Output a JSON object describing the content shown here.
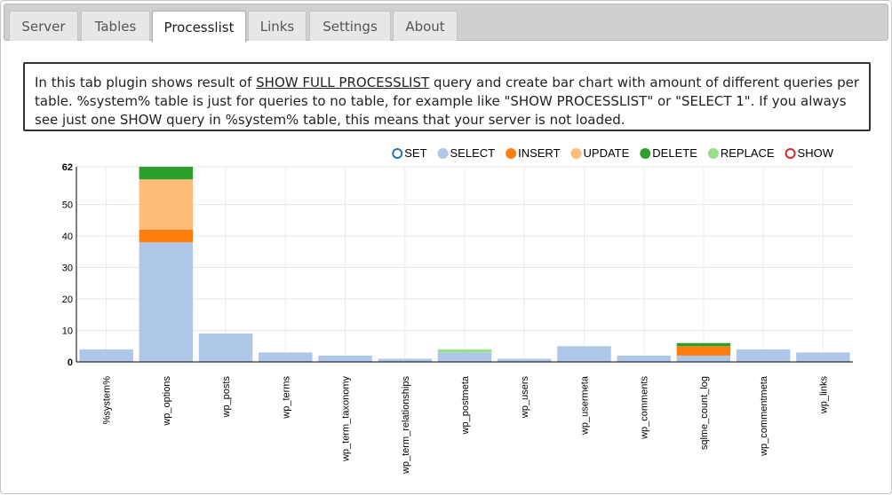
{
  "tabs": [
    {
      "label": "Server",
      "active": false
    },
    {
      "label": "Tables",
      "active": false
    },
    {
      "label": "Processlist",
      "active": true
    },
    {
      "label": "Links",
      "active": false
    },
    {
      "label": "Settings",
      "active": false
    },
    {
      "label": "About",
      "active": false
    }
  ],
  "description": {
    "before": "In this tab plugin shows result of ",
    "link": "SHOW FULL PROCESSLIST",
    "after": " query and create bar chart with amount of different queries per table. %system% table is just for queries to no table, for example like \"SHOW PROCESSLIST\" or \"SELECT 1\". If you always see just one SHOW query in %system% table, this means that your server is not loaded."
  },
  "chart_data": {
    "type": "bar",
    "stacked": true,
    "categories": [
      "%system%",
      "wp_options",
      "wp_posts",
      "wp_terms",
      "wp_term_taxonomy",
      "wp_term_relationships",
      "wp_postmeta",
      "wp_users",
      "wp_usermeta",
      "wp_comments",
      "sqlme_count_log",
      "wp_commentmeta",
      "wp_links"
    ],
    "series": [
      {
        "name": "SET",
        "color": "#1f77b4",
        "values": [
          0,
          0,
          0,
          0,
          0,
          0,
          0,
          0,
          0,
          0,
          0,
          0,
          0
        ]
      },
      {
        "name": "SELECT",
        "color": "#aec7e8",
        "values": [
          4,
          38,
          9,
          3,
          2,
          1,
          3,
          1,
          5,
          2,
          2,
          4,
          3
        ]
      },
      {
        "name": "INSERT",
        "color": "#ff7f0e",
        "values": [
          0,
          4,
          0,
          0,
          0,
          0,
          0,
          0,
          0,
          0,
          3,
          0,
          0
        ]
      },
      {
        "name": "UPDATE",
        "color": "#ffbb78",
        "values": [
          0,
          16,
          0,
          0,
          0,
          0,
          0,
          0,
          0,
          0,
          0,
          0,
          0
        ]
      },
      {
        "name": "DELETE",
        "color": "#2ca02c",
        "values": [
          0,
          4,
          0,
          0,
          0,
          0,
          0,
          0,
          0,
          0,
          1,
          0,
          0
        ]
      },
      {
        "name": "REPLACE",
        "color": "#98df8a",
        "values": [
          0,
          0,
          0,
          0,
          0,
          0,
          1,
          0,
          0,
          0,
          0,
          0,
          0
        ]
      },
      {
        "name": "SHOW",
        "color": "#d62728",
        "values": [
          0,
          0,
          0,
          0,
          0,
          0,
          0,
          0,
          0,
          0,
          0,
          0,
          0
        ]
      }
    ],
    "yticks": [
      0,
      10,
      20,
      30,
      40,
      50
    ],
    "ymax_label": 62,
    "ylim": [
      0,
      62
    ],
    "grid": true,
    "legend_position": "top-right"
  }
}
